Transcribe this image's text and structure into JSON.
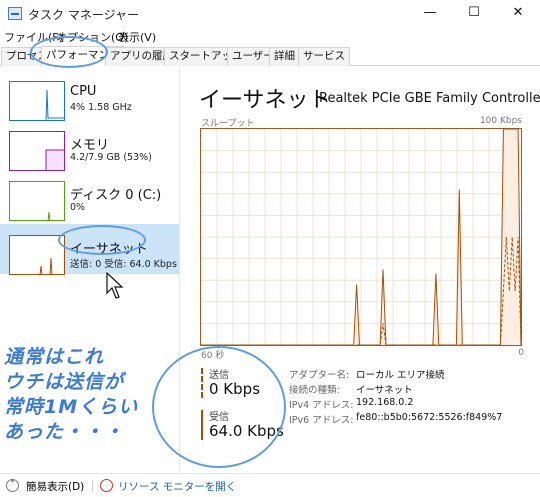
{
  "window": {
    "title": "タスク マネージャー",
    "minimize": "—",
    "maximize": "☐",
    "close": "✕"
  },
  "menu": [
    "ファイル(F)",
    "オプション(O)",
    "表示(V)"
  ],
  "tabs": [
    "プロセス",
    "パフォーマンス",
    "アプリの履歴",
    "スタートアップ",
    "ユーザー",
    "詳細",
    "サービス"
  ],
  "active_tab": "パフォーマンス",
  "sidebar": {
    "items": [
      {
        "name": "CPU",
        "sub": "4%  1.58 GHz",
        "color": "#1779ba"
      },
      {
        "name": "メモリ",
        "sub": "4.2/7.9 GB (53%)",
        "color": "#8e1eaa"
      },
      {
        "name": "ディスク 0 (C:)",
        "sub": "0%",
        "color": "#4da60c"
      },
      {
        "name": "イーサネット",
        "sub": "送信: 0  受信: 64.0 Kbps",
        "color": "#a74f01"
      }
    ],
    "selected_index": 3
  },
  "main": {
    "title": "イーサネット",
    "adapter": "Realtek PCIe GBE Family Controller",
    "chart_top_left": "スループット",
    "chart_top_right": "100 Kbps",
    "chart_bottom_left": "60 秒",
    "chart_bottom_right": "0",
    "send_label": "送信",
    "send_value": "0 Kbps",
    "recv_label": "受信",
    "recv_value": "64.0 Kbps",
    "info": [
      {
        "key": "アダプター名:",
        "value": "ローカル エリア接続"
      },
      {
        "key": "接続の種類:",
        "value": "イーサネット"
      },
      {
        "key": "IPv4 アドレス:",
        "value": "192.168.0.2"
      },
      {
        "key": "IPv6 アドレス:",
        "value": "fe80::b5b0:5672:5526:f849%7"
      }
    ]
  },
  "footer": {
    "simple_view": "簡易表示(D)",
    "resource_monitor": "リソース モニターを開く"
  },
  "annotation": {
    "lines": [
      "通常はこれ",
      "ウチは送信が",
      "常時1Mくらい",
      "あった・・・"
    ],
    "color": "#3a7bd5"
  },
  "chart_data": {
    "type": "area",
    "xlabel": "60 秒",
    "ylim": [
      0,
      100
    ],
    "series": [
      {
        "name": "受信",
        "values": [
          0,
          0,
          0,
          0,
          0,
          0,
          0,
          0,
          0,
          0,
          0,
          0,
          0,
          0,
          0,
          0,
          0,
          0,
          0,
          0,
          0,
          0,
          0,
          0,
          0,
          0,
          0,
          0,
          0,
          0,
          0,
          0,
          0,
          0,
          0,
          0,
          0,
          0,
          0,
          0,
          0,
          0,
          0,
          0,
          0,
          0,
          0,
          0,
          0,
          0,
          0,
          0,
          0,
          28,
          0,
          0,
          0,
          0,
          0,
          0,
          0,
          0,
          35,
          0,
          0,
          0,
          0,
          0,
          0,
          0,
          0,
          0,
          0,
          0,
          0,
          0,
          0,
          0,
          0,
          0,
          33,
          0,
          0,
          0,
          0,
          0,
          0,
          0,
          72,
          0,
          0,
          0,
          0,
          0,
          0,
          0,
          0,
          0,
          0,
          0,
          0,
          0,
          0,
          100,
          100,
          100,
          100,
          100,
          100,
          0
        ]
      },
      {
        "name": "送信",
        "values": [
          0,
          0,
          0,
          0,
          0,
          0,
          0,
          0,
          0,
          0,
          0,
          0,
          0,
          0,
          0,
          0,
          0,
          0,
          0,
          0,
          0,
          0,
          0,
          0,
          0,
          0,
          0,
          0,
          0,
          0,
          0,
          0,
          0,
          0,
          0,
          0,
          0,
          0,
          0,
          0,
          0,
          0,
          0,
          0,
          0,
          0,
          0,
          0,
          0,
          0,
          0,
          0,
          0,
          0,
          0,
          0,
          0,
          0,
          0,
          0,
          0,
          0,
          10,
          0,
          0,
          0,
          0,
          0,
          0,
          0,
          0,
          0,
          0,
          0,
          0,
          0,
          0,
          0,
          0,
          0,
          0,
          0,
          0,
          0,
          0,
          0,
          0,
          0,
          0,
          0,
          0,
          0,
          0,
          0,
          0,
          0,
          0,
          0,
          0,
          0,
          0,
          0,
          0,
          25,
          50,
          25,
          50,
          25,
          50,
          0
        ]
      }
    ]
  }
}
